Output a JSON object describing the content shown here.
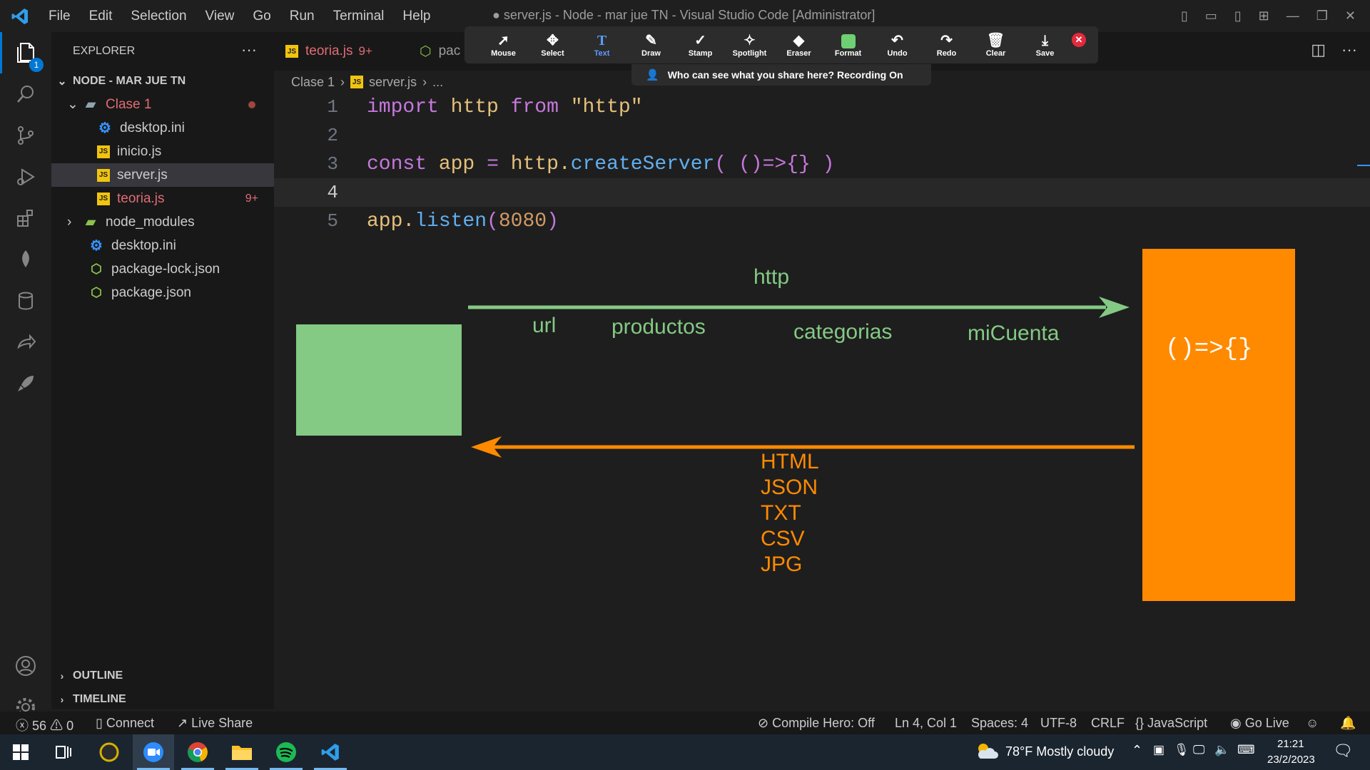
{
  "window": {
    "title": "● server.js - Node - mar jue TN - Visual Studio Code [Administrator]",
    "menu": [
      "File",
      "Edit",
      "Selection",
      "View",
      "Go",
      "Run",
      "Terminal",
      "Help"
    ]
  },
  "zoom_toolbar": {
    "tools": [
      {
        "label": "Mouse",
        "icon": "cursor-icon"
      },
      {
        "label": "Select",
        "icon": "move-icon"
      },
      {
        "label": "Text",
        "icon": "text-icon",
        "active": true
      },
      {
        "label": "Draw",
        "icon": "pen-icon"
      },
      {
        "label": "Stamp",
        "icon": "check-icon"
      },
      {
        "label": "Spotlight",
        "icon": "wand-icon"
      },
      {
        "label": "Eraser",
        "icon": "eraser-icon"
      },
      {
        "label": "Format",
        "icon": "format-icon"
      },
      {
        "label": "Undo",
        "icon": "undo-icon"
      },
      {
        "label": "Redo",
        "icon": "redo-icon"
      },
      {
        "label": "Clear",
        "icon": "trash-icon"
      },
      {
        "label": "Save",
        "icon": "save-icon"
      }
    ],
    "format_color": "#6fcf73",
    "share_notice": "Who can see what you share here? Recording On"
  },
  "activity_bar": {
    "explorer_badge": "1"
  },
  "sidebar": {
    "title": "EXPLORER",
    "root": "NODE - MAR JUE TN",
    "folder": "Clase 1",
    "files": [
      {
        "name": "desktop.ini",
        "icon": "gear-icon"
      },
      {
        "name": "inicio.js",
        "icon": "js-icon"
      },
      {
        "name": "server.js",
        "icon": "js-icon",
        "selected": true
      },
      {
        "name": "teoria.js",
        "icon": "js-icon",
        "badge": "9+"
      }
    ],
    "root_items": [
      {
        "name": "node_modules",
        "icon": "folder-icon"
      },
      {
        "name": "desktop.ini",
        "icon": "gear-icon"
      },
      {
        "name": "package-lock.json",
        "icon": "json-icon"
      },
      {
        "name": "package.json",
        "icon": "json-icon"
      }
    ],
    "sections": [
      "OUTLINE",
      "TIMELINE"
    ]
  },
  "tabs": [
    {
      "label": "teoria.js",
      "badge": "9+"
    },
    {
      "label": "pac"
    }
  ],
  "breadcrumb": {
    "folder": "Clase 1",
    "file": "server.js",
    "more": "..."
  },
  "editor": {
    "line_numbers": [
      "1",
      "2",
      "3",
      "4",
      "5"
    ],
    "line1": {
      "kw1": "import",
      "id": "http",
      "kw2": "from",
      "str": "\"http\""
    },
    "line3": {
      "kw": "const",
      "id": "app",
      "eq": "=",
      "obj": "http.",
      "fn": "createServer",
      "open": "(",
      "arrow": " ()=>{} ",
      "close": ")"
    },
    "line5": {
      "obj": "app.",
      "fn": "listen",
      "open": "(",
      "num": "8080",
      "close": ")"
    }
  },
  "drawing": {
    "request_label": "http",
    "request_items": [
      "url",
      "productos",
      "categorias",
      "miCuenta"
    ],
    "handler_label": "()=>{}",
    "response_items": [
      "HTML",
      "JSON",
      "TXT",
      "CSV",
      "JPG"
    ],
    "green": "#84c984",
    "orange": "#ff8a00"
  },
  "statusbar": {
    "errors": "56",
    "warnings": "0",
    "connect": "Connect",
    "live_share": "Live Share",
    "compile_hero": "Compile Hero: Off",
    "position": "Ln 4, Col 1",
    "spaces": "Spaces: 4",
    "encoding": "UTF-8",
    "eol": "CRLF",
    "language": "JavaScript",
    "go_live": "Go Live"
  },
  "taskbar": {
    "weather": "78°F  Mostly cloudy",
    "time": "21:21",
    "date": "23/2/2023"
  }
}
